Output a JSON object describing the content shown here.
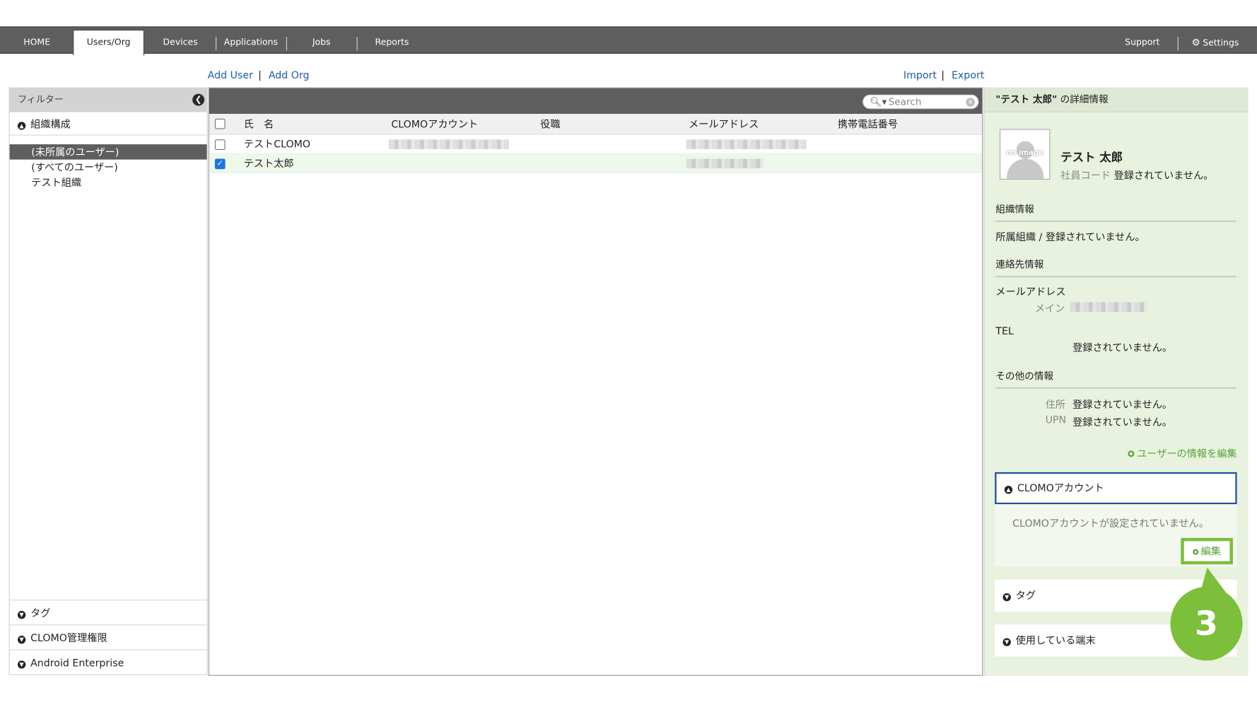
{
  "nav": {
    "tabs": [
      "HOME",
      "Users/Org",
      "Devices",
      "Applications",
      "Jobs",
      "Reports"
    ],
    "support": "Support",
    "settings": "Settings"
  },
  "actions": {
    "add_user": "Add User",
    "add_org": "Add Org",
    "import": "Import",
    "export": "Export",
    "pipe": "|"
  },
  "filter": {
    "title": "フィルター",
    "org_section": "組織構成",
    "tree": [
      "(未所属のユーザー)",
      "(すべてのユーザー)",
      "テスト組織"
    ],
    "bottom_sections": [
      "タグ",
      "CLOMO管理権限",
      "Android Enterprise"
    ]
  },
  "list": {
    "search_placeholder": "Search",
    "columns": [
      "氏　名",
      "CLOMOアカウント",
      "役職",
      "メールアドレス",
      "携帯電話番号"
    ],
    "rows": [
      {
        "name": "テストCLOMO",
        "checked": false
      },
      {
        "name": "テスト太郎",
        "checked": true
      }
    ]
  },
  "detail": {
    "title_name": "\"テスト 太郎\"",
    "title_suffix": " の詳細情報",
    "avatar_text": "no image",
    "user_name": "テスト 太郎",
    "employee_code_label": "社員コード",
    "not_registered": "登録されていません。",
    "org_info_head": "組織情報",
    "org_info_text": "所属組織 / 登録されていません。",
    "contact_head": "連絡先情報",
    "email_label": "メールアドレス",
    "email_main_label": "メイン",
    "tel_label": "TEL",
    "other_head": "その他の情報",
    "address_label": "住所",
    "upn_label": "UPN",
    "edit_user_link": "ユーザーの情報を編集",
    "clomo_account_section": "CLOMOアカウント",
    "clomo_account_msg": "CLOMOアカウントが設定されていません。",
    "edit_button": "編集",
    "tag_section": "タグ",
    "devices_section": "使用している端末"
  },
  "callout": {
    "step": "3"
  },
  "colors": {
    "accent_green": "#7cbf3a",
    "nav_bg": "#5e5e5e",
    "link_blue": "#1b5ea6",
    "focus_blue": "#1f4fa0"
  }
}
